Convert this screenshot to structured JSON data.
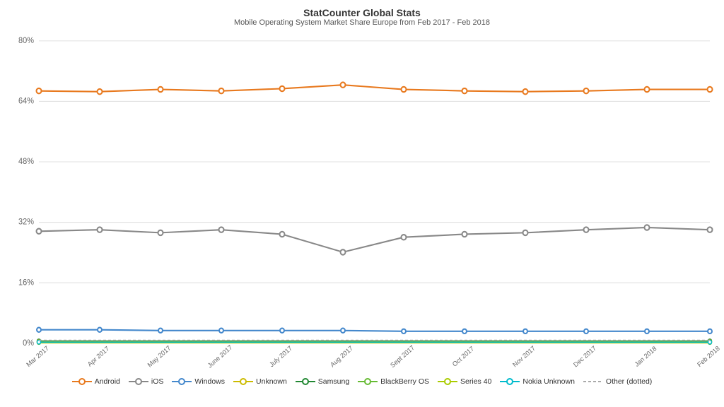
{
  "title": {
    "main": "StatCounter Global Stats",
    "sub": "Mobile Operating System Market Share Europe from Feb 2017 - Feb 2018"
  },
  "chart": {
    "yLabels": [
      "80%",
      "64%",
      "48%",
      "32%",
      "16%",
      "0%"
    ],
    "xLabels": [
      "Mar 2017",
      "Apr 2017",
      "May 2017",
      "June 2017",
      "July 2017",
      "Aug 2017",
      "Sept 2017",
      "Oct 2017",
      "Nov 2017",
      "Dec 2017",
      "Jan 2018",
      "Feb 2018"
    ],
    "colors": {
      "android": "#e8791e",
      "ios": "#888888",
      "windows": "#4488cc",
      "unknown": "#ccbb00",
      "samsung": "#228833",
      "blackberry": "#33aa33",
      "series40": "#aacc00",
      "nokiaUnknown": "#00bbcc",
      "other": "#aaaaaa"
    }
  },
  "legend": {
    "items": [
      {
        "id": "android",
        "label": "Android",
        "color": "#e8791e",
        "dotted": false
      },
      {
        "id": "ios",
        "label": "iOS",
        "color": "#888888",
        "dotted": false
      },
      {
        "id": "windows",
        "label": "Windows",
        "color": "#4488cc",
        "dotted": false
      },
      {
        "id": "unknown",
        "label": "Unknown",
        "color": "#ccbb00",
        "dotted": false
      },
      {
        "id": "samsung",
        "label": "Samsung",
        "color": "#228833",
        "dotted": false
      },
      {
        "id": "blackberry",
        "label": "BlackBerry OS",
        "color": "#33aa33",
        "dotted": false
      },
      {
        "id": "series40",
        "label": "Series 40",
        "color": "#aacc00",
        "dotted": false
      },
      {
        "id": "nokiaunknown",
        "label": "Nokia Unknown",
        "color": "#00bbcc",
        "dotted": false
      },
      {
        "id": "other",
        "label": "Other (dotted)",
        "color": "#aaaaaa",
        "dotted": true
      }
    ]
  }
}
